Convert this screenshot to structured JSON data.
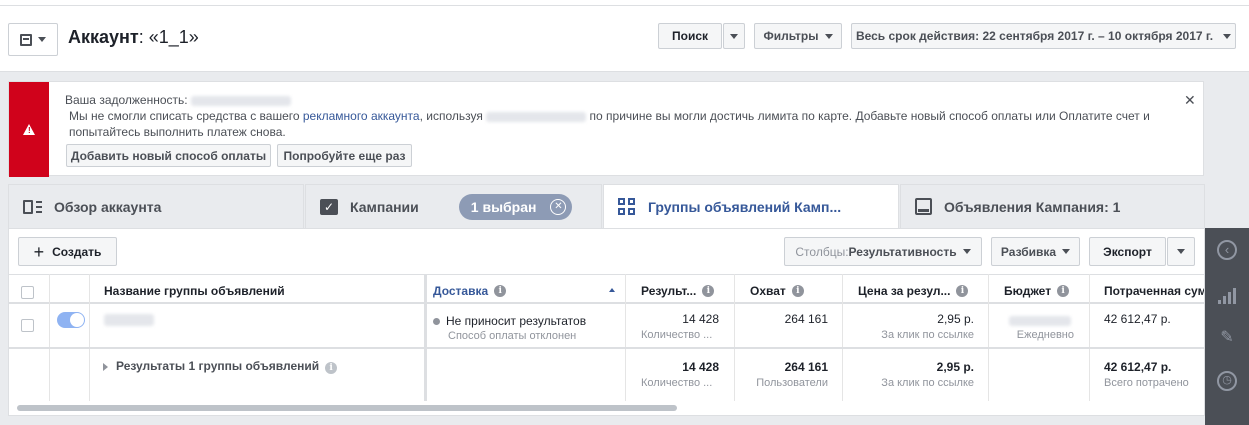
{
  "header": {
    "account_label": "Аккаунт",
    "account_name": ": «1_1»",
    "search_label": "Поиск",
    "filters_label": "Фильтры",
    "date_range": "Весь срок действия: 22 сентября 2017 г. – 10 октября 2017 г."
  },
  "alert": {
    "debt_label": "Ваша задолженность:",
    "line1_a": "Мы не смогли списать средства с вашего ",
    "line1_link": "рекламного аккаунта",
    "line1_b": ", используя",
    "line1_c": "по причине вы могли достичь лимита по карте. Добавьте новый способ оплаты или Оплатите счет и",
    "line2": "попытайтесь выполнить платеж снова.",
    "add_payment_button": "Добавить новый способ оплаты",
    "retry_button": "Попробуйте еще раз"
  },
  "tabs": [
    {
      "label": "Обзор аккаунта"
    },
    {
      "label": "Кампании"
    },
    {
      "label": "Группы объявлений Камп..."
    },
    {
      "label": "Объявления Кампания: 1"
    }
  ],
  "selected_chip": "1 выбран",
  "toolbar": {
    "create_label": "Создать",
    "columns_prefix": "Столбцы: ",
    "columns_value": "Результативность",
    "breakdown_label": "Разбивка",
    "export_label": "Экспорт"
  },
  "table": {
    "headers": {
      "name": "Название группы объявлений",
      "delivery": "Доставка",
      "results": "Результ...",
      "reach": "Охват",
      "cost": "Цена за резул...",
      "budget": "Бюджет",
      "spent": "Потраченная сум"
    },
    "row": {
      "delivery_status": "Не приносит результатов",
      "delivery_sub": "Способ оплаты отклонен",
      "results": "14 428",
      "results_sub": "Количество ...",
      "reach": "264 161",
      "cost": "2,95 р.",
      "cost_sub": "За клик по ссылке",
      "budget_sub": "Ежедневно",
      "spent": "42 612,47 р."
    },
    "summary": {
      "label": "Результаты 1 группы объявлений",
      "results": "14 428",
      "results_sub": "Количество ...",
      "reach": "264 161",
      "reach_sub": "Пользователи",
      "cost": "2,95 р.",
      "cost_sub": "За клик по ссылке",
      "spent": "42 612,47 р.",
      "spent_sub": "Всего потрачено"
    }
  },
  "colors": {
    "brand_blue": "#365899",
    "alert_red": "#d0021b",
    "chip_bg": "#8d9bb5",
    "toggle_on": "#8fb3f2"
  }
}
